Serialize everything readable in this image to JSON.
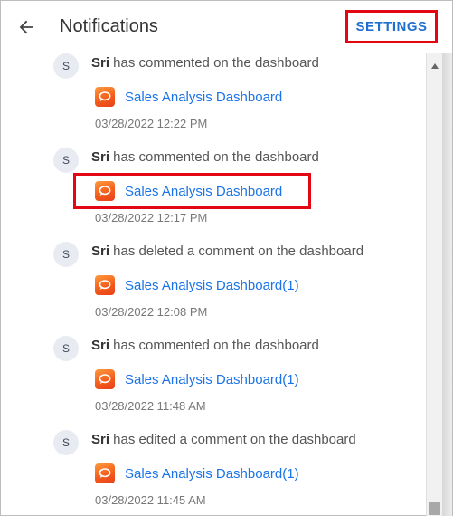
{
  "header": {
    "title": "Notifications",
    "settings_label": "SETTINGS"
  },
  "notifications": [
    {
      "avatar": "S",
      "user": "Sri",
      "action": " has commented on the dashboard",
      "dashboard": "Sales Analysis Dashboard",
      "time": "03/28/2022 12:22 PM"
    },
    {
      "avatar": "S",
      "user": "Sri",
      "action": " has commented on the dashboard",
      "dashboard": "Sales Analysis Dashboard",
      "time": "03/28/2022 12:17 PM"
    },
    {
      "avatar": "S",
      "user": "Sri",
      "action": " has deleted a comment on the dashboard",
      "dashboard": "Sales Analysis Dashboard(1)",
      "time": "03/28/2022 12:08 PM"
    },
    {
      "avatar": "S",
      "user": "Sri",
      "action": " has commented on the dashboard",
      "dashboard": "Sales Analysis Dashboard(1)",
      "time": "03/28/2022 11:48 AM"
    },
    {
      "avatar": "S",
      "user": "Sri",
      "action": " has edited a comment on the dashboard",
      "dashboard": "Sales Analysis Dashboard(1)",
      "time": "03/28/2022 11:45 AM"
    }
  ],
  "icons": {
    "back": "arrow-left-icon",
    "dashboard": "comment-bubble-icon",
    "scroll_up": "triangle-up-icon",
    "scroll_down": "triangle-down-icon"
  },
  "colors": {
    "accent": "#1a73e8",
    "highlight": "#e30613",
    "icon_gradient_start": "#ff9a3c",
    "icon_gradient_end": "#e8401b"
  }
}
